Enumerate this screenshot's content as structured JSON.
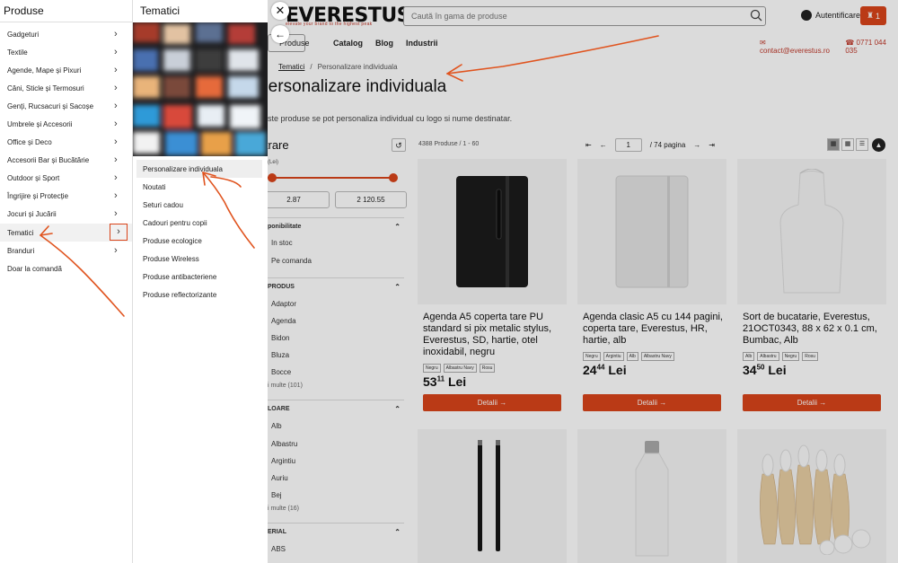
{
  "header": {
    "logo": "EVERESTUS",
    "logo_tagline": "elevate your brand to the highest peak",
    "search_placeholder": "Caută în gama de produse",
    "account_label": "Autentificare",
    "cart_count": "1",
    "menu_button_label": "Produse",
    "nav_links": [
      "Catalog",
      "Blog",
      "Industrii"
    ],
    "contact_email": "contact@everestus.ro",
    "contact_phone": "0771 044 035"
  },
  "breadcrumb": {
    "link": "Tematici",
    "separator": "/",
    "current": "Personalizare individuala"
  },
  "page": {
    "title": "Personalizare individuala",
    "description": "este produse se pot personaliza individual cu logo si nume destinatar."
  },
  "filters": {
    "title": "ltrare",
    "price_label": "(Lei)",
    "price_min": "2.87",
    "price_max": "2 120.55",
    "availability_title": "ponibilitate",
    "availability_options": [
      "In stoc",
      "Pe comanda"
    ],
    "product_title": "PRODUS",
    "product_options": [
      "Adaptor",
      "Agenda",
      "Bidon",
      "Bluza",
      "Bocce"
    ],
    "product_more": "i multe (101)",
    "color_title": "LOARE",
    "color_options": [
      "Alb",
      "Albastru",
      "Argintiu",
      "Auriu",
      "Bej"
    ],
    "color_more": "i multe (16)",
    "material_title": "ERIAL",
    "material_options": [
      "ABS"
    ]
  },
  "listing": {
    "count": "4388 Produse / 1 - 60",
    "page": "1",
    "total_pages": "/ 74 pagina",
    "products": [
      {
        "title": "Agenda A5 coperta tare PU standard si pix metalic stylus, Everestus, SD, hartie, otel inoxidabil, negru",
        "tags": [
          "Negru",
          "Albastru Navy",
          "Rosu"
        ],
        "price_int": "53",
        "price_dec": "11",
        "currency": "Lei",
        "button": "Detalii →"
      },
      {
        "title": "Agenda clasic A5 cu 144 pagini, coperta tare, Everestus, HR, hartie, alb",
        "tags": [
          "Negru",
          "Argintiu",
          "Alb",
          "Albastru Navy"
        ],
        "price_int": "24",
        "price_dec": "44",
        "currency": "Lei",
        "button": "Detalii →"
      },
      {
        "title": "Sort de bucatarie, Everestus, 21OCT0343, 88 x 62 x 0.1 cm, Bumbac, Alb",
        "tags": [
          "Alb",
          "Albastru",
          "Negru",
          "Rosu"
        ],
        "price_int": "34",
        "price_dec": "50",
        "currency": "Lei",
        "button": "Detalii →"
      }
    ]
  },
  "menu": {
    "title": "Produse",
    "items": [
      "Gadgeturi",
      "Textile",
      "Agende, Mape și Pixuri",
      "Căni, Sticle și Termosuri",
      "Genți, Rucsacuri și Sacoșe",
      "Umbrele și Accesorii",
      "Office și Deco",
      "Accesorii Bar și Bucătărie",
      "Outdoor și Sport",
      "Îngrijire și Protecție",
      "Jocuri și Jucării",
      "Tematici",
      "Branduri",
      "Doar la comandă"
    ],
    "active_index": 11
  },
  "submenu": {
    "title": "Tematici",
    "items": [
      "Personalizare individuala",
      "Noutati",
      "Seturi cadou",
      "Cadouri pentru copii",
      "Produse ecologice",
      "Produse Wireless",
      "Produse antibacteriene",
      "Produse reflectorizante"
    ],
    "active_index": 0
  },
  "colors": {
    "accent": "#d9441a",
    "annotation": "#e0541f"
  },
  "icons": {
    "close": "close-icon",
    "back": "arrow-left-icon",
    "chevron": "chevron-right-icon",
    "search": "search-icon",
    "account": "user-icon",
    "cart": "basket-icon"
  }
}
